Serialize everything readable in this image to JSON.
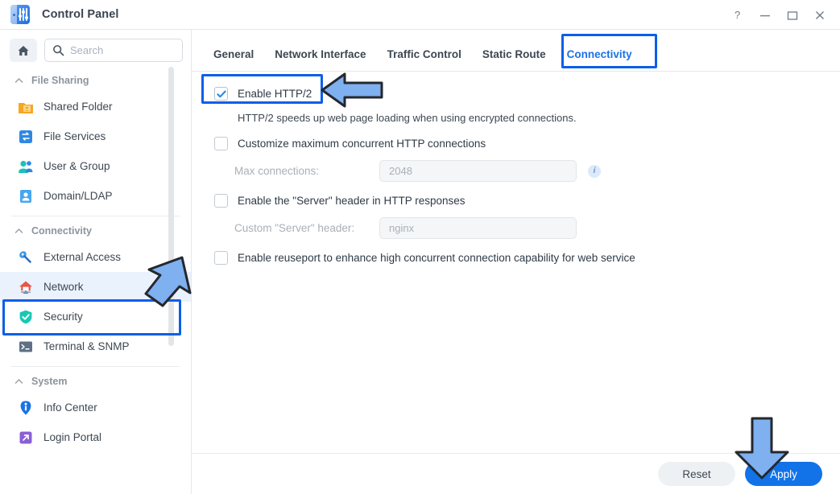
{
  "window": {
    "title": "Control Panel",
    "app_icon": "control-panel-icon",
    "controls": [
      {
        "name": "help-button",
        "glyph": "?"
      },
      {
        "name": "minimize-button",
        "glyph": "—"
      },
      {
        "name": "maximize-button",
        "glyph": "▭"
      },
      {
        "name": "close-button",
        "glyph": "✕"
      }
    ]
  },
  "sidebar": {
    "home_icon": "home-icon",
    "search": {
      "icon": "search-icon",
      "placeholder": "Search",
      "value": ""
    },
    "groups": [
      {
        "label": "File Sharing",
        "collapse_icon": "chevron-up-icon",
        "items": [
          {
            "label": "Shared Folder",
            "icon": "shared-folder-icon",
            "selected": false
          },
          {
            "label": "File Services",
            "icon": "file-services-icon",
            "selected": false
          },
          {
            "label": "User & Group",
            "icon": "user-group-icon",
            "selected": false
          },
          {
            "label": "Domain/LDAP",
            "icon": "domain-ldap-icon",
            "selected": false
          }
        ]
      },
      {
        "label": "Connectivity",
        "collapse_icon": "chevron-up-icon",
        "items": [
          {
            "label": "External Access",
            "icon": "external-access-icon",
            "selected": false
          },
          {
            "label": "Network",
            "icon": "network-icon",
            "selected": true
          },
          {
            "label": "Security",
            "icon": "security-shield-icon",
            "selected": false
          },
          {
            "label": "Terminal & SNMP",
            "icon": "terminal-icon",
            "selected": false
          }
        ]
      },
      {
        "label": "System",
        "collapse_icon": "chevron-up-icon",
        "items": [
          {
            "label": "Info Center",
            "icon": "info-center-icon",
            "selected": false
          },
          {
            "label": "Login Portal",
            "icon": "login-portal-icon",
            "selected": false
          }
        ]
      }
    ]
  },
  "main": {
    "tabs": [
      {
        "label": "General",
        "active": false
      },
      {
        "label": "Network Interface",
        "active": false
      },
      {
        "label": "Traffic Control",
        "active": false
      },
      {
        "label": "Static Route",
        "active": false
      },
      {
        "label": "Connectivity",
        "active": true
      }
    ],
    "options": {
      "http2": {
        "label": "Enable HTTP/2",
        "checked": true,
        "description": "HTTP/2 speeds up web page loading when using encrypted connections."
      },
      "max_conn": {
        "label": "Customize maximum concurrent HTTP connections",
        "checked": false,
        "field_label": "Max connections:",
        "field_placeholder": "2048",
        "field_value": "",
        "info_icon": "info-icon"
      },
      "server_header": {
        "label": "Enable the \"Server\" header in HTTP responses",
        "checked": false,
        "field_label": "Custom \"Server\" header:",
        "field_placeholder": "nginx",
        "field_value": ""
      },
      "reuseport": {
        "label": "Enable reuseport to enhance high concurrent connection capability for web service",
        "checked": false
      }
    },
    "footer": {
      "reset_label": "Reset",
      "apply_label": "Apply"
    }
  },
  "annotations": {
    "highlight_color": "#0b5fe8",
    "arrow_fill": "#7fb0f0",
    "arrow_stroke": "#24282e",
    "boxes": [
      {
        "name": "highlight-connectivity-tab",
        "target": "Connectivity"
      },
      {
        "name": "highlight-enable-http2",
        "target": "Enable HTTP/2"
      },
      {
        "name": "highlight-network-sidebar",
        "target": "Network"
      }
    ],
    "arrows": [
      {
        "name": "arrow-to-enable-http2",
        "direction": "left"
      },
      {
        "name": "arrow-to-network",
        "direction": "down-right"
      },
      {
        "name": "arrow-to-apply",
        "direction": "down"
      }
    ]
  },
  "colors": {
    "accent": "#1272e8",
    "tab_active": "#1a73e8",
    "text": "#2f3a45",
    "muted": "#a8b0b9"
  }
}
